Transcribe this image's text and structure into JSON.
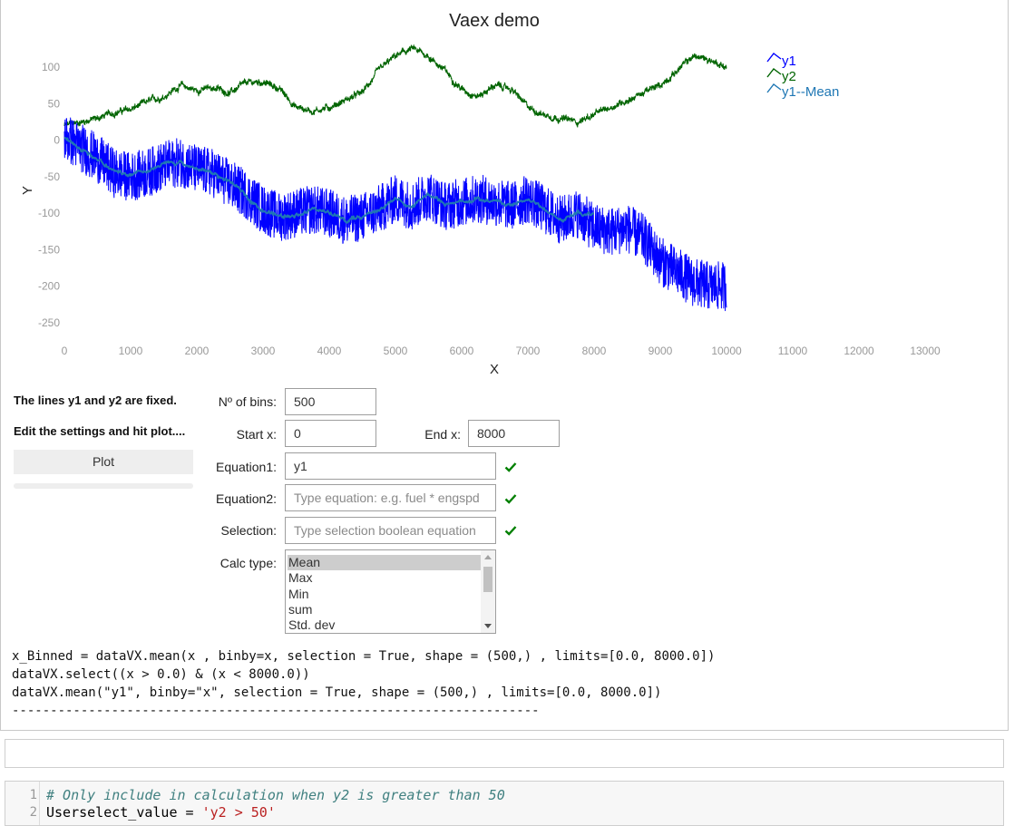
{
  "chart_data": {
    "type": "line",
    "title": "Vaex demo",
    "xlabel": "X",
    "ylabel": "Y",
    "xlim": [
      0,
      13500
    ],
    "ylim": [
      -270,
      130
    ],
    "x_ticks": [
      "0",
      "1000",
      "2000",
      "3000",
      "4000",
      "5000",
      "6000",
      "7000",
      "8000",
      "9000",
      "10000",
      "11000",
      "12000",
      "13000"
    ],
    "y_ticks": [
      "100",
      "50",
      "0",
      "-50",
      "-100",
      "-150",
      "-200",
      "-250"
    ],
    "legend_position": "top-right",
    "grid": false,
    "series": [
      {
        "name": "y1",
        "color": "#0000ff",
        "x": [
          0,
          250,
          500,
          750,
          1000,
          1250,
          1500,
          1750,
          2000,
          2250,
          2500,
          2750,
          3000,
          3250,
          3500,
          3750,
          4000,
          4250,
          4500,
          4750,
          5000,
          5250,
          5500,
          5750,
          6000,
          6250,
          6500,
          6750,
          7000,
          7250,
          7500,
          7750,
          8000,
          8250,
          8500,
          8750,
          9000,
          9250,
          9500,
          9750,
          10000
        ],
        "y": [
          5,
          -10,
          -25,
          -45,
          -50,
          -45,
          -35,
          -30,
          -40,
          -45,
          -60,
          -75,
          -95,
          -105,
          -100,
          -95,
          -100,
          -110,
          -105,
          -95,
          -80,
          -90,
          -75,
          -90,
          -85,
          -80,
          -85,
          -90,
          -80,
          -95,
          -110,
          -100,
          -120,
          -125,
          -120,
          -135,
          -165,
          -180,
          -195,
          -200,
          -200
        ],
        "spread": 42
      },
      {
        "name": "y2",
        "color": "#006400",
        "x": [
          0,
          250,
          500,
          750,
          1000,
          1250,
          1500,
          1750,
          2000,
          2250,
          2500,
          2750,
          3000,
          3250,
          3500,
          3750,
          4000,
          4250,
          4500,
          4750,
          5000,
          5250,
          5500,
          5750,
          6000,
          6250,
          6500,
          6750,
          7000,
          7250,
          7500,
          7750,
          8000,
          8250,
          8500,
          8750,
          9000,
          9250,
          9500,
          9750,
          10000
        ],
        "y": [
          20,
          25,
          30,
          38,
          42,
          52,
          60,
          75,
          68,
          72,
          65,
          78,
          80,
          70,
          45,
          40,
          45,
          55,
          65,
          95,
          115,
          125,
          115,
          95,
          70,
          60,
          75,
          70,
          45,
          35,
          30,
          25,
          35,
          45,
          55,
          65,
          75,
          95,
          115,
          110,
          100
        ],
        "spread": 12
      },
      {
        "name": "y1--Mean",
        "color": "#1f77b4",
        "x": [
          0,
          250,
          500,
          750,
          1000,
          1250,
          1500,
          1750,
          2000,
          2250,
          2500,
          2750,
          3000,
          3250,
          3500,
          3750,
          4000,
          4250,
          4500,
          4750,
          5000,
          5250,
          5500,
          5750,
          6000,
          6250,
          6500,
          6750,
          7000,
          7250,
          7500,
          7750,
          8000
        ],
        "y": [
          5,
          -10,
          -25,
          -45,
          -50,
          -45,
          -35,
          -30,
          -40,
          -45,
          -60,
          -75,
          -95,
          -105,
          -100,
          -95,
          -100,
          -110,
          -105,
          -95,
          -80,
          -90,
          -75,
          -90,
          -85,
          -80,
          -85,
          -90,
          -80,
          -95,
          -110,
          -100,
          -100
        ],
        "spread": 6
      }
    ]
  },
  "sidebar": {
    "line1": "The lines y1 and y2 are fixed.",
    "line2": "Edit the settings and hit plot....",
    "plot_label": "Plot"
  },
  "form": {
    "bins_label": "Nº of bins:",
    "bins_value": "500",
    "startx_label": "Start x:",
    "startx_value": "0",
    "endx_label": "End x:",
    "endx_value": "8000",
    "eq1_label": "Equation1:",
    "eq1_value": "y1",
    "eq2_label": "Equation2:",
    "eq2_placeholder": "Type equation: e.g.  fuel * engspd",
    "sel_label": "Selection:",
    "sel_placeholder": "Type selection boolean equation",
    "calc_label": "Calc type:",
    "calc_options": [
      "Mean",
      "Max",
      "Min",
      "sum",
      "Std. dev"
    ],
    "calc_selected": "Mean",
    "check_color": "#008000"
  },
  "output": {
    "lines": [
      "x_Binned = dataVX.mean(x , binby=x, selection = True, shape = (500,) , limits=[0.0, 8000.0])",
      "dataVX.select((x > 0.0) & (x < 8000.0))",
      "dataVX.mean(\"y1\", binby=\"x\", selection = True, shape = (500,) , limits=[0.0, 8000.0])",
      "---------------------------------------------------------------------"
    ]
  },
  "code": {
    "line_numbers": [
      "1",
      "2"
    ],
    "line1": "# Only include in calculation when y2 is greater than 50",
    "line2_code": "Userselect_value = ",
    "line2_str": "'y2 > 50'"
  }
}
